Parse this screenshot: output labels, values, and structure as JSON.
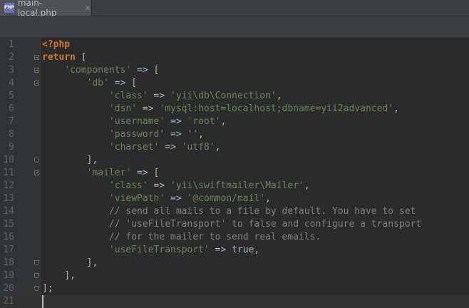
{
  "tab": {
    "filename": "main-local.php",
    "icon": "php-file-icon",
    "icon_text": "PHP",
    "close": "×"
  },
  "colors": {
    "background": "#2b2b2b",
    "keyword": "#cc7832",
    "string": "#6a8759",
    "comment": "#808080",
    "text": "#a9b7c6",
    "line_number": "#606366"
  },
  "lines": [
    {
      "num": "1",
      "fold": "",
      "tokens": [
        {
          "t": "kw",
          "v": "<?php"
        }
      ]
    },
    {
      "num": "2",
      "fold": "open",
      "tokens": [
        {
          "t": "kw",
          "v": "return"
        },
        {
          "t": "op",
          "v": " ["
        }
      ]
    },
    {
      "num": "3",
      "fold": "open",
      "tokens": [
        {
          "t": "op",
          "v": "    "
        },
        {
          "t": "str",
          "v": "'components'"
        },
        {
          "t": "op",
          "v": " => ["
        }
      ]
    },
    {
      "num": "4",
      "fold": "open",
      "tokens": [
        {
          "t": "op",
          "v": "        "
        },
        {
          "t": "str",
          "v": "'db'"
        },
        {
          "t": "op",
          "v": " => ["
        }
      ]
    },
    {
      "num": "5",
      "fold": "",
      "tokens": [
        {
          "t": "op",
          "v": "            "
        },
        {
          "t": "str",
          "v": "'class'"
        },
        {
          "t": "op",
          "v": " => "
        },
        {
          "t": "str",
          "v": "'yii\\db\\Connection'"
        },
        {
          "t": "op",
          "v": ","
        }
      ]
    },
    {
      "num": "6",
      "fold": "",
      "tokens": [
        {
          "t": "op",
          "v": "            "
        },
        {
          "t": "str",
          "v": "'dsn'"
        },
        {
          "t": "op",
          "v": " => "
        },
        {
          "t": "str",
          "v": "'mysql:host=localhost;dbname=yii2advanced'"
        },
        {
          "t": "op",
          "v": ","
        }
      ]
    },
    {
      "num": "7",
      "fold": "",
      "tokens": [
        {
          "t": "op",
          "v": "            "
        },
        {
          "t": "str",
          "v": "'username'"
        },
        {
          "t": "op",
          "v": " => "
        },
        {
          "t": "str",
          "v": "'root'"
        },
        {
          "t": "op",
          "v": ","
        }
      ]
    },
    {
      "num": "8",
      "fold": "",
      "tokens": [
        {
          "t": "op",
          "v": "            "
        },
        {
          "t": "str",
          "v": "'password'"
        },
        {
          "t": "op",
          "v": " => "
        },
        {
          "t": "str",
          "v": "''"
        },
        {
          "t": "op",
          "v": ","
        }
      ]
    },
    {
      "num": "9",
      "fold": "",
      "tokens": [
        {
          "t": "op",
          "v": "            "
        },
        {
          "t": "str",
          "v": "'charset'"
        },
        {
          "t": "op",
          "v": " => "
        },
        {
          "t": "str",
          "v": "'utf8'"
        },
        {
          "t": "op",
          "v": ","
        }
      ]
    },
    {
      "num": "10",
      "fold": "close",
      "tokens": [
        {
          "t": "op",
          "v": "        ],"
        }
      ]
    },
    {
      "num": "11",
      "fold": "open",
      "tokens": [
        {
          "t": "op",
          "v": "        "
        },
        {
          "t": "str",
          "v": "'mailer'"
        },
        {
          "t": "op",
          "v": " => ["
        }
      ]
    },
    {
      "num": "12",
      "fold": "",
      "tokens": [
        {
          "t": "op",
          "v": "            "
        },
        {
          "t": "str",
          "v": "'class'"
        },
        {
          "t": "op",
          "v": " => "
        },
        {
          "t": "str",
          "v": "'yii\\swiftmailer\\Mailer'"
        },
        {
          "t": "op",
          "v": ","
        }
      ]
    },
    {
      "num": "13",
      "fold": "",
      "tokens": [
        {
          "t": "op",
          "v": "            "
        },
        {
          "t": "str",
          "v": "'viewPath'"
        },
        {
          "t": "op",
          "v": " => "
        },
        {
          "t": "str",
          "v": "'@common/mail'"
        },
        {
          "t": "op",
          "v": ","
        }
      ]
    },
    {
      "num": "14",
      "fold": "",
      "tokens": [
        {
          "t": "op",
          "v": "            "
        },
        {
          "t": "cm",
          "v": "// send all mails to a file by default. You have to set"
        }
      ]
    },
    {
      "num": "15",
      "fold": "",
      "tokens": [
        {
          "t": "op",
          "v": "            "
        },
        {
          "t": "cm",
          "v": "// 'useFileTransport' to false and configure a transport"
        }
      ]
    },
    {
      "num": "16",
      "fold": "",
      "tokens": [
        {
          "t": "op",
          "v": "            "
        },
        {
          "t": "cm",
          "v": "// for the mailer to send real emails."
        }
      ]
    },
    {
      "num": "17",
      "fold": "",
      "tokens": [
        {
          "t": "op",
          "v": "            "
        },
        {
          "t": "str",
          "v": "'useFileTransport'"
        },
        {
          "t": "op",
          "v": " => "
        },
        {
          "t": "plain",
          "v": "true"
        },
        {
          "t": "op",
          "v": ","
        }
      ]
    },
    {
      "num": "18",
      "fold": "close",
      "tokens": [
        {
          "t": "op",
          "v": "        ],"
        }
      ]
    },
    {
      "num": "19",
      "fold": "close",
      "tokens": [
        {
          "t": "op",
          "v": "    ],"
        }
      ]
    },
    {
      "num": "20",
      "fold": "close",
      "tokens": [
        {
          "t": "op",
          "v": "];"
        }
      ]
    },
    {
      "num": "21",
      "fold": "",
      "tokens": []
    }
  ],
  "current_line": "21"
}
